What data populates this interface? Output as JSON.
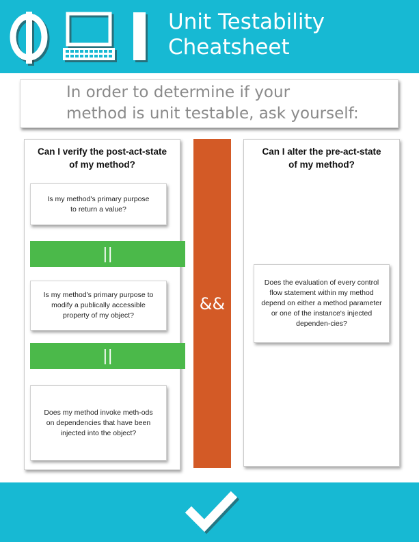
{
  "header": {
    "title_line1": "Unit Testability",
    "title_line2": "Cheatsheet",
    "logo_icons": [
      "phi-symbol-icon",
      "computer-icon",
      "bar-icon"
    ]
  },
  "intro": {
    "line1": "In order to determine if your",
    "line2": "method is unit testable, ask yourself:"
  },
  "left_column": {
    "heading_line1": "Can I verify the post-act-state",
    "heading_line2": "of my method?",
    "questions": [
      "Is my method's primary purpose to return a value?",
      "Is my method's primary purpose to modify a publically accessible property of my object?",
      "Does my method invoke meth-ods on dependencies that have been injected into the object?"
    ],
    "or_label": "||"
  },
  "and_label": "&&",
  "right_column": {
    "heading_line1": "Can I alter the pre-act-state",
    "heading_line2": "of my method?",
    "question": "Does the evaluation of every control flow statement within my method depend on either a method parameter or one of the instance's injected dependen-cies?"
  },
  "footer": {
    "icon": "checkmark-icon"
  },
  "colors": {
    "header": "#17b9d3",
    "or": "#4bb94a",
    "and": "#d35a26"
  }
}
